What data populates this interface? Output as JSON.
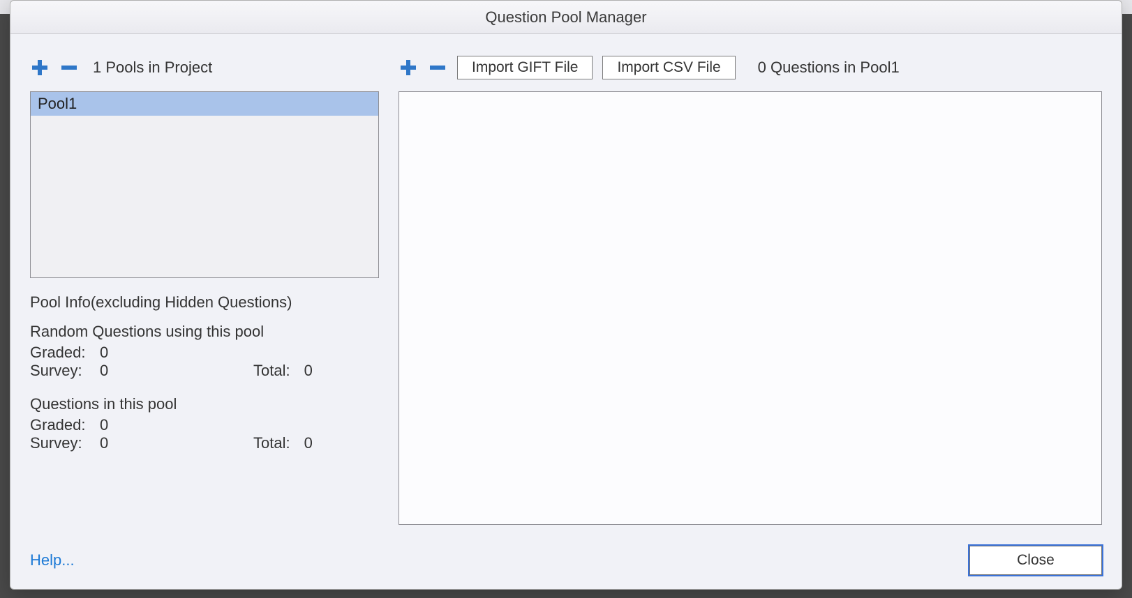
{
  "window": {
    "title": "Question Pool Manager"
  },
  "pools": {
    "count_label": "1 Pools in Project",
    "items": [
      "Pool1"
    ],
    "selected_index": 0
  },
  "questions": {
    "count_label": "0 Questions in Pool1",
    "import_gift_label": "Import GIFT File",
    "import_csv_label": "Import CSV File"
  },
  "info": {
    "heading": "Pool Info(excluding Hidden Questions)",
    "random": {
      "title": "Random Questions using this pool",
      "graded_label": "Graded:",
      "graded_value": "0",
      "survey_label": "Survey:",
      "survey_value": "0",
      "total_label": "Total:",
      "total_value": "0"
    },
    "pool": {
      "title": "Questions in this pool",
      "graded_label": "Graded:",
      "graded_value": "0",
      "survey_label": "Survey:",
      "survey_value": "0",
      "total_label": "Total:",
      "total_value": "0"
    }
  },
  "footer": {
    "help_label": "Help...",
    "close_label": "Close"
  }
}
